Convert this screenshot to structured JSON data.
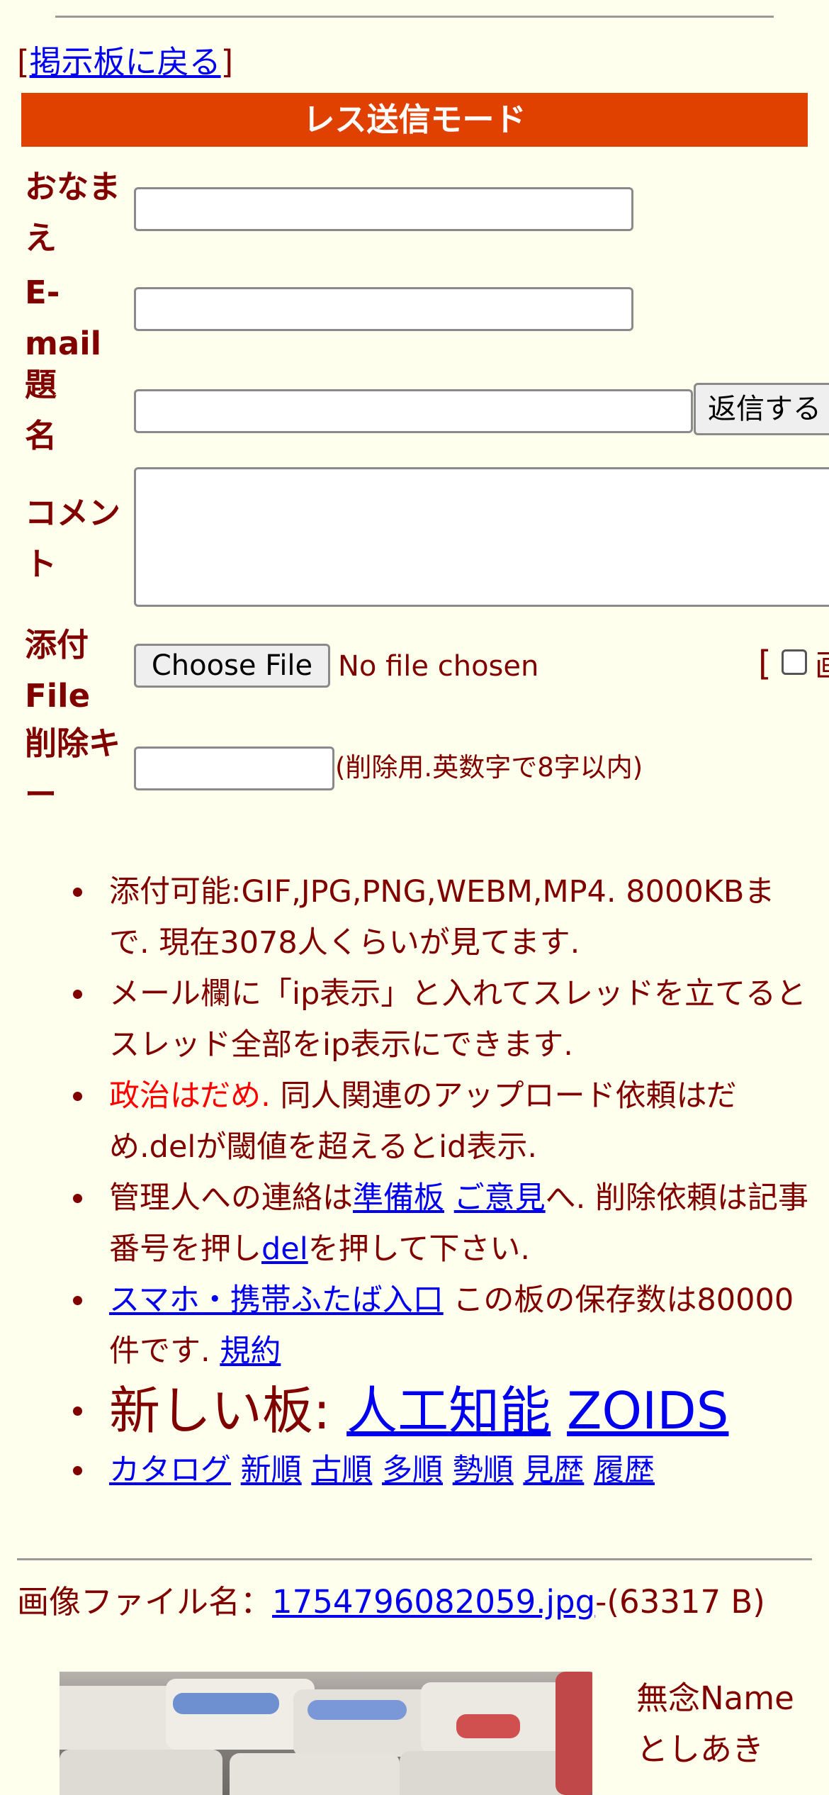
{
  "nav": {
    "bracket_open": "[",
    "back_label": "掲示板に戻る",
    "bracket_close": "]"
  },
  "form": {
    "mode_title": "レス送信モード",
    "labels": {
      "name": "おなまえ",
      "email": "E-mail",
      "subject": "題名",
      "comment": "コメント",
      "file": "添付File",
      "delkey": "削除キー"
    },
    "name_value": "",
    "email_value": "",
    "subject_value": "",
    "comment_value": "",
    "submit_label": "返信する",
    "choose_file_label": "Choose File",
    "no_file_label": "No file chosen",
    "option_bracket": "[",
    "option_cut_char": "画",
    "delkey_value": "",
    "delkey_hint": "(削除用.英数字で8字以内)"
  },
  "rules": {
    "r1": "添付可能:GIF,JPG,PNG,WEBM,MP4. 8000KBまで. 現在3078人くらいが見てます.",
    "r2": "メール欄に「ip表示」と入れてスレッドを立てるとスレッド全部をip表示にできます.",
    "r3_red": "政治はだめ.",
    "r3_rest": " 同人関連のアップロード依頼はだめ.delが閾値を超えるとid表示.",
    "r4_a": "管理人への連絡は",
    "r4_link1": "準備板",
    "r4_link2": "ご意見",
    "r4_b": "へ. 削除依頼は記事番号を押し",
    "r4_link3": "del",
    "r4_c": "を押して下さい.",
    "r5_link": "スマホ・携帯ふたば入口",
    "r5_text": " この板の保存数は80000件です. ",
    "r5_link2": "規約",
    "r6_prefix": "新しい板: ",
    "r6_link1": "人工知能",
    "r6_link2": "ZOIDS",
    "sort_links": [
      "カタログ",
      "新順",
      "古順",
      "多順",
      "勢順",
      "見歴",
      "履歴"
    ]
  },
  "post": {
    "file_prefix": "画像ファイル名：",
    "file_name": "1754796082059.jpg",
    "file_size": "-(63317 B)",
    "poster_name": "無念Name",
    "poster_subject": "としあき"
  }
}
